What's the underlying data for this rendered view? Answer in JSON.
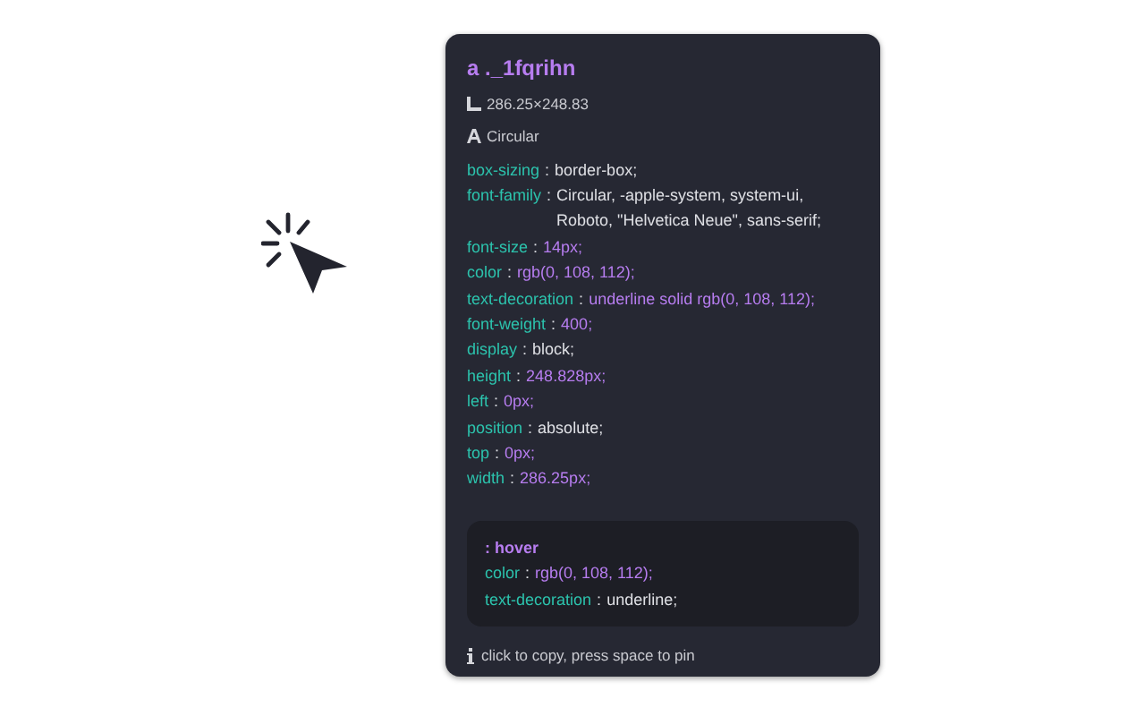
{
  "inspector": {
    "selector": "a ._1fqrihn",
    "size": "286.25×248.83",
    "font": "Circular",
    "properties": [
      {
        "name": "box-sizing",
        "sep": ":",
        "value": "border-box;",
        "kind": "keyword"
      },
      {
        "name": "font-family",
        "sep": ":",
        "value": "Circular, -apple-system, system-ui, Roboto, \"Helvetica Neue\", sans-serif;",
        "kind": "keyword"
      },
      {
        "name": "font-size",
        "sep": ":",
        "value": "14px;",
        "kind": "numeric"
      },
      {
        "name": "color",
        "sep": ":",
        "value": "rgb(0, 108, 112);",
        "kind": "numeric"
      },
      {
        "name": "text-decoration",
        "sep": ":",
        "value": "underline solid rgb(0, 108, 112);",
        "kind": "numeric"
      },
      {
        "name": "font-weight",
        "sep": ":",
        "value": "400;",
        "kind": "numeric"
      },
      {
        "name": "display",
        "sep": ":",
        "value": "block;",
        "kind": "keyword"
      },
      {
        "name": "height",
        "sep": ":",
        "value": "248.828px;",
        "kind": "numeric"
      },
      {
        "name": "left",
        "sep": ":",
        "value": "0px;",
        "kind": "numeric"
      },
      {
        "name": "position",
        "sep": ":",
        "value": "absolute;",
        "kind": "keyword"
      },
      {
        "name": "top",
        "sep": ":",
        "value": "0px;",
        "kind": "numeric"
      },
      {
        "name": "width",
        "sep": ":",
        "value": "286.25px;",
        "kind": "numeric"
      }
    ],
    "hover": {
      "title": ": hover",
      "properties": [
        {
          "name": "color",
          "sep": ":",
          "value": "rgb(0, 108, 112);",
          "kind": "numeric"
        },
        {
          "name": "text-decoration",
          "sep": ":",
          "value": "underline;",
          "kind": "keyword"
        }
      ]
    },
    "hint": "click to copy, press space to pin"
  }
}
